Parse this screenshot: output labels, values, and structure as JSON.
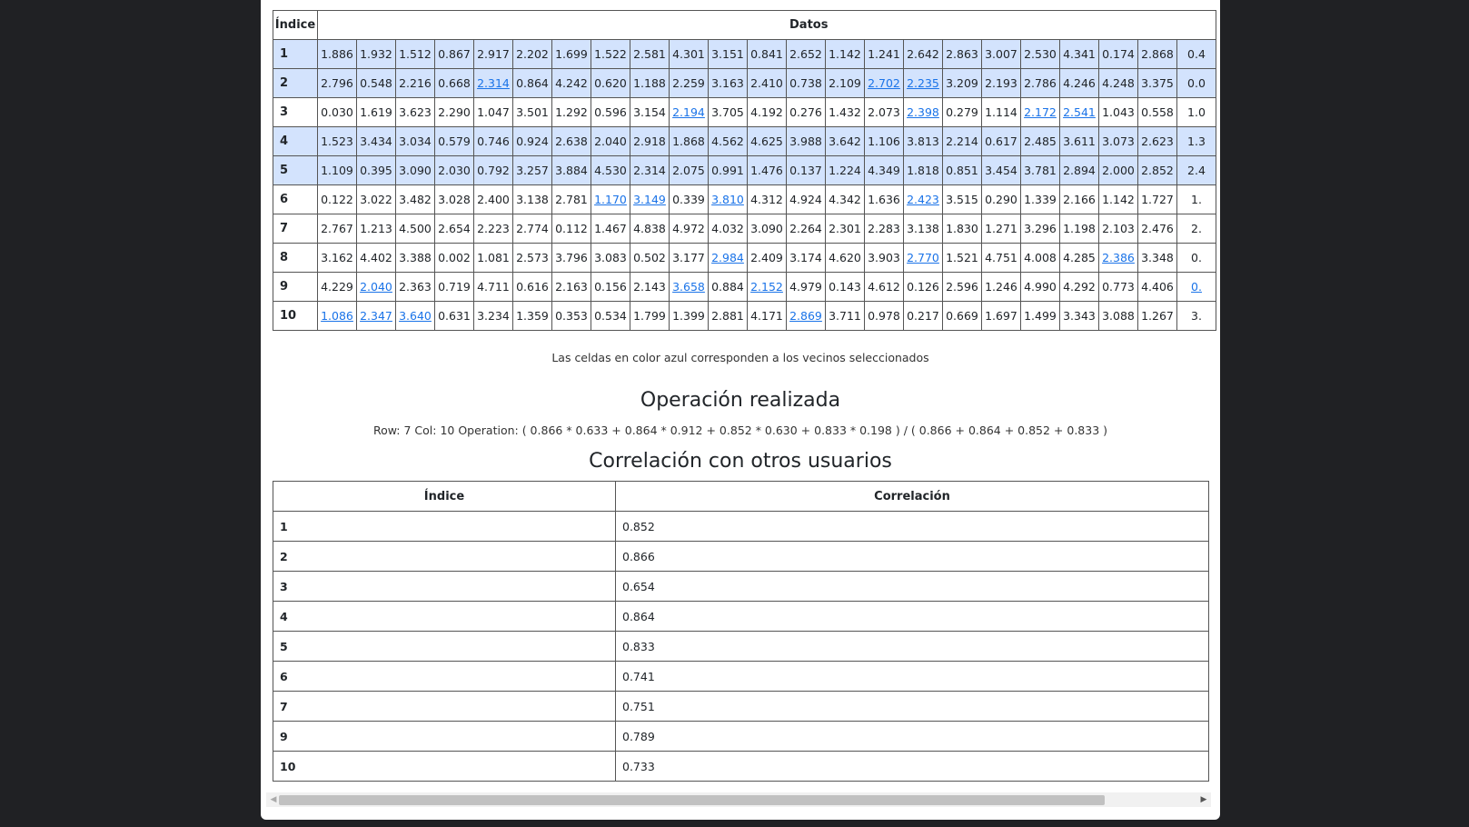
{
  "data_table": {
    "header_index": "Índice",
    "header_data": "Datos",
    "rows": [
      {
        "index": "1",
        "selected": true,
        "cells": [
          {
            "v": "1.886"
          },
          {
            "v": "1.932"
          },
          {
            "v": "1.512"
          },
          {
            "v": "0.867"
          },
          {
            "v": "2.917"
          },
          {
            "v": "2.202"
          },
          {
            "v": "1.699"
          },
          {
            "v": "1.522"
          },
          {
            "v": "2.581"
          },
          {
            "v": "4.301"
          },
          {
            "v": "3.151"
          },
          {
            "v": "0.841"
          },
          {
            "v": "2.652"
          },
          {
            "v": "1.142"
          },
          {
            "v": "1.241"
          },
          {
            "v": "2.642"
          },
          {
            "v": "2.863"
          },
          {
            "v": "3.007"
          },
          {
            "v": "2.530"
          },
          {
            "v": "4.341"
          },
          {
            "v": "0.174"
          },
          {
            "v": "2.868"
          },
          {
            "v": "0.4"
          }
        ]
      },
      {
        "index": "2",
        "selected": true,
        "cells": [
          {
            "v": "2.796"
          },
          {
            "v": "0.548"
          },
          {
            "v": "2.216"
          },
          {
            "v": "0.668"
          },
          {
            "v": "2.314",
            "n": true
          },
          {
            "v": "0.864"
          },
          {
            "v": "4.242"
          },
          {
            "v": "0.620"
          },
          {
            "v": "1.188"
          },
          {
            "v": "2.259"
          },
          {
            "v": "3.163"
          },
          {
            "v": "2.410"
          },
          {
            "v": "0.738"
          },
          {
            "v": "2.109"
          },
          {
            "v": "2.702",
            "n": true
          },
          {
            "v": "2.235",
            "n": true
          },
          {
            "v": "3.209"
          },
          {
            "v": "2.193"
          },
          {
            "v": "2.786"
          },
          {
            "v": "4.246"
          },
          {
            "v": "4.248"
          },
          {
            "v": "3.375"
          },
          {
            "v": "0.0"
          }
        ]
      },
      {
        "index": "3",
        "selected": false,
        "cells": [
          {
            "v": "0.030"
          },
          {
            "v": "1.619"
          },
          {
            "v": "3.623"
          },
          {
            "v": "2.290"
          },
          {
            "v": "1.047"
          },
          {
            "v": "3.501"
          },
          {
            "v": "1.292"
          },
          {
            "v": "0.596"
          },
          {
            "v": "3.154"
          },
          {
            "v": "2.194",
            "n": true
          },
          {
            "v": "3.705"
          },
          {
            "v": "4.192"
          },
          {
            "v": "0.276"
          },
          {
            "v": "1.432"
          },
          {
            "v": "2.073"
          },
          {
            "v": "2.398",
            "n": true
          },
          {
            "v": "0.279"
          },
          {
            "v": "1.114"
          },
          {
            "v": "2.172",
            "n": true
          },
          {
            "v": "2.541",
            "n": true
          },
          {
            "v": "1.043"
          },
          {
            "v": "0.558"
          },
          {
            "v": "1.0"
          }
        ]
      },
      {
        "index": "4",
        "selected": true,
        "cells": [
          {
            "v": "1.523"
          },
          {
            "v": "3.434"
          },
          {
            "v": "3.034"
          },
          {
            "v": "0.579"
          },
          {
            "v": "0.746"
          },
          {
            "v": "0.924"
          },
          {
            "v": "2.638"
          },
          {
            "v": "2.040"
          },
          {
            "v": "2.918"
          },
          {
            "v": "1.868"
          },
          {
            "v": "4.562"
          },
          {
            "v": "4.625"
          },
          {
            "v": "3.988"
          },
          {
            "v": "3.642"
          },
          {
            "v": "1.106"
          },
          {
            "v": "3.813"
          },
          {
            "v": "2.214"
          },
          {
            "v": "0.617"
          },
          {
            "v": "2.485"
          },
          {
            "v": "3.611"
          },
          {
            "v": "3.073"
          },
          {
            "v": "2.623"
          },
          {
            "v": "1.3"
          }
        ]
      },
      {
        "index": "5",
        "selected": true,
        "cells": [
          {
            "v": "1.109"
          },
          {
            "v": "0.395"
          },
          {
            "v": "3.090"
          },
          {
            "v": "2.030"
          },
          {
            "v": "0.792"
          },
          {
            "v": "3.257"
          },
          {
            "v": "3.884"
          },
          {
            "v": "4.530"
          },
          {
            "v": "2.314"
          },
          {
            "v": "2.075"
          },
          {
            "v": "0.991"
          },
          {
            "v": "1.476"
          },
          {
            "v": "0.137"
          },
          {
            "v": "1.224"
          },
          {
            "v": "4.349"
          },
          {
            "v": "1.818"
          },
          {
            "v": "0.851"
          },
          {
            "v": "3.454"
          },
          {
            "v": "3.781"
          },
          {
            "v": "2.894"
          },
          {
            "v": "2.000"
          },
          {
            "v": "2.852"
          },
          {
            "v": "2.4"
          }
        ]
      },
      {
        "index": "6",
        "selected": false,
        "cells": [
          {
            "v": "0.122"
          },
          {
            "v": "3.022"
          },
          {
            "v": "3.482"
          },
          {
            "v": "3.028"
          },
          {
            "v": "2.400"
          },
          {
            "v": "3.138"
          },
          {
            "v": "2.781"
          },
          {
            "v": "1.170",
            "n": true
          },
          {
            "v": "3.149",
            "n": true
          },
          {
            "v": "0.339"
          },
          {
            "v": "3.810",
            "n": true
          },
          {
            "v": "4.312"
          },
          {
            "v": "4.924"
          },
          {
            "v": "4.342"
          },
          {
            "v": "1.636"
          },
          {
            "v": "2.423",
            "n": true
          },
          {
            "v": "3.515"
          },
          {
            "v": "0.290"
          },
          {
            "v": "1.339"
          },
          {
            "v": "2.166"
          },
          {
            "v": "1.142"
          },
          {
            "v": "1.727"
          },
          {
            "v": "1."
          }
        ]
      },
      {
        "index": "7",
        "selected": false,
        "cells": [
          {
            "v": "2.767"
          },
          {
            "v": "1.213"
          },
          {
            "v": "4.500"
          },
          {
            "v": "2.654"
          },
          {
            "v": "2.223"
          },
          {
            "v": "2.774"
          },
          {
            "v": "0.112"
          },
          {
            "v": "1.467"
          },
          {
            "v": "4.838"
          },
          {
            "v": "4.972"
          },
          {
            "v": "4.032"
          },
          {
            "v": "3.090"
          },
          {
            "v": "2.264"
          },
          {
            "v": "2.301"
          },
          {
            "v": "2.283"
          },
          {
            "v": "3.138"
          },
          {
            "v": "1.830"
          },
          {
            "v": "1.271"
          },
          {
            "v": "3.296"
          },
          {
            "v": "1.198"
          },
          {
            "v": "2.103"
          },
          {
            "v": "2.476"
          },
          {
            "v": "2."
          }
        ]
      },
      {
        "index": "8",
        "selected": false,
        "cells": [
          {
            "v": "3.162"
          },
          {
            "v": "4.402"
          },
          {
            "v": "3.388"
          },
          {
            "v": "0.002"
          },
          {
            "v": "1.081"
          },
          {
            "v": "2.573"
          },
          {
            "v": "3.796"
          },
          {
            "v": "3.083"
          },
          {
            "v": "0.502"
          },
          {
            "v": "3.177"
          },
          {
            "v": "2.984",
            "n": true
          },
          {
            "v": "2.409"
          },
          {
            "v": "3.174"
          },
          {
            "v": "4.620"
          },
          {
            "v": "3.903"
          },
          {
            "v": "2.770",
            "n": true
          },
          {
            "v": "1.521"
          },
          {
            "v": "4.751"
          },
          {
            "v": "4.008"
          },
          {
            "v": "4.285"
          },
          {
            "v": "2.386",
            "n": true
          },
          {
            "v": "3.348"
          },
          {
            "v": "0."
          }
        ]
      },
      {
        "index": "9",
        "selected": false,
        "cells": [
          {
            "v": "4.229"
          },
          {
            "v": "2.040",
            "n": true
          },
          {
            "v": "2.363"
          },
          {
            "v": "0.719"
          },
          {
            "v": "4.711"
          },
          {
            "v": "0.616"
          },
          {
            "v": "2.163"
          },
          {
            "v": "0.156"
          },
          {
            "v": "2.143"
          },
          {
            "v": "3.658",
            "n": true
          },
          {
            "v": "0.884"
          },
          {
            "v": "2.152",
            "n": true
          },
          {
            "v": "4.979"
          },
          {
            "v": "0.143"
          },
          {
            "v": "4.612"
          },
          {
            "v": "0.126"
          },
          {
            "v": "2.596"
          },
          {
            "v": "1.246"
          },
          {
            "v": "4.990"
          },
          {
            "v": "4.292"
          },
          {
            "v": "0.773"
          },
          {
            "v": "4.406"
          },
          {
            "v": "0.",
            "n": true
          }
        ]
      },
      {
        "index": "10",
        "selected": false,
        "cells": [
          {
            "v": "1.086",
            "n": true
          },
          {
            "v": "2.347",
            "n": true
          },
          {
            "v": "3.640",
            "n": true
          },
          {
            "v": "0.631"
          },
          {
            "v": "3.234"
          },
          {
            "v": "1.359"
          },
          {
            "v": "0.353"
          },
          {
            "v": "0.534"
          },
          {
            "v": "1.799"
          },
          {
            "v": "1.399"
          },
          {
            "v": "2.881"
          },
          {
            "v": "4.171"
          },
          {
            "v": "2.869",
            "n": true
          },
          {
            "v": "3.711"
          },
          {
            "v": "0.978"
          },
          {
            "v": "0.217"
          },
          {
            "v": "0.669"
          },
          {
            "v": "1.697"
          },
          {
            "v": "1.499"
          },
          {
            "v": "3.343"
          },
          {
            "v": "3.088"
          },
          {
            "v": "1.267"
          },
          {
            "v": "3."
          }
        ]
      }
    ]
  },
  "caption": "Las celdas en color azul corresponden a los vecinos seleccionados",
  "operation": {
    "title": "Operación realizada",
    "text": "Row: 7 Col: 10 Operation: ( 0.866 * 0.633 + 0.864 * 0.912 + 0.852 * 0.630 + 0.833 * 0.198 ) / ( 0.866 + 0.864 + 0.852 + 0.833 )"
  },
  "correlation": {
    "title": "Correlación con otros usuarios",
    "header_index": "Índice",
    "header_value": "Correlación",
    "rows": [
      {
        "index": "1",
        "value": "0.852"
      },
      {
        "index": "2",
        "value": "0.866"
      },
      {
        "index": "3",
        "value": "0.654"
      },
      {
        "index": "4",
        "value": "0.864"
      },
      {
        "index": "5",
        "value": "0.833"
      },
      {
        "index": "6",
        "value": "0.741"
      },
      {
        "index": "7",
        "value": "0.751"
      },
      {
        "index": "9",
        "value": "0.789"
      },
      {
        "index": "10",
        "value": "0.733"
      }
    ]
  },
  "colors": {
    "background": "#202124",
    "selected_row": "#d3e3fd",
    "neighbor_link": "#1a73e8"
  }
}
